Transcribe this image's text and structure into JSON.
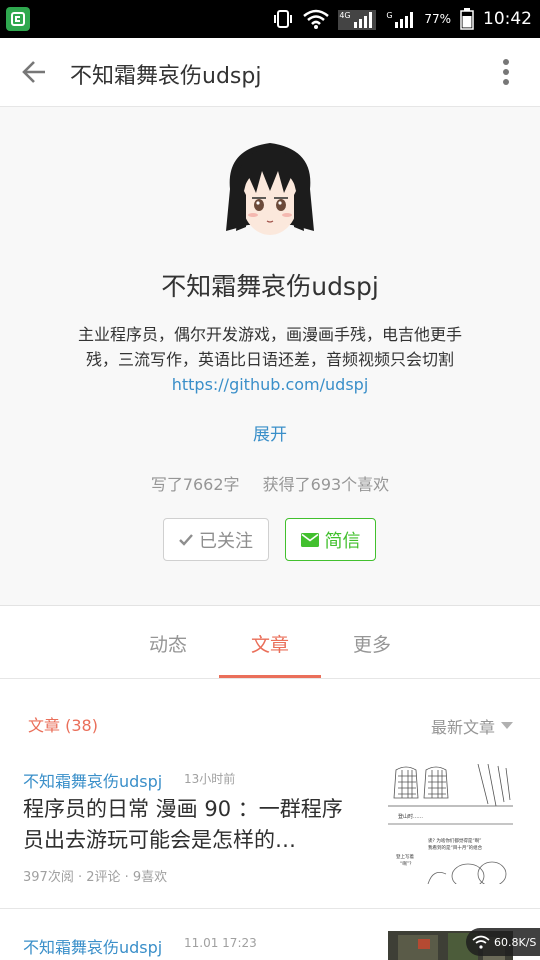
{
  "status_bar": {
    "battery": "77%",
    "time": "10:42",
    "signal1_label": "4G",
    "signal2_label": "G"
  },
  "appbar": {
    "title": "不知霜舞哀伤udspj"
  },
  "profile": {
    "name": "不知霜舞哀伤udspj",
    "bio_line1": "主业程序员，偶尔开发游戏，画漫画手残，电吉他更手",
    "bio_line2": "残，三流写作，英语比日语还差，音频视频只会切割",
    "link": "https://github.com/udspj",
    "expand_label": "展开",
    "stats_words": "写了7662字",
    "stats_likes": "获得了693个喜欢",
    "follow_label": "已关注",
    "message_label": "简信"
  },
  "tabs": [
    {
      "label": "动态"
    },
    {
      "label": "文章"
    },
    {
      "label": "更多"
    }
  ],
  "active_tab": "文章",
  "section": {
    "title": "文章 (38)",
    "sort_label": "最新文章"
  },
  "articles": [
    {
      "author": "不知霜舞哀伤udspj",
      "time": "13小时前",
      "title": "程序员的日常 漫画 90 ：一群程序员出去游玩可能会是怎样的…",
      "meta": "397次阅 · 2评论 · 9喜欢",
      "thumb_text1": "登山时……",
      "thumb_text2": "诶? 为啥你们都觉得是“啊”",
      "thumb_text3": "我看到的是“目十月”的组合",
      "thumb_text4": "登上写着",
      "thumb_text5": "“啊”？"
    },
    {
      "author": "不知霜舞哀伤udspj",
      "time": "11.01 17:23"
    }
  ],
  "net_badge": "60.8K/S",
  "colors": {
    "accent": "#ea6f5a",
    "link": "#3a8fc9",
    "green": "#42c02e"
  }
}
